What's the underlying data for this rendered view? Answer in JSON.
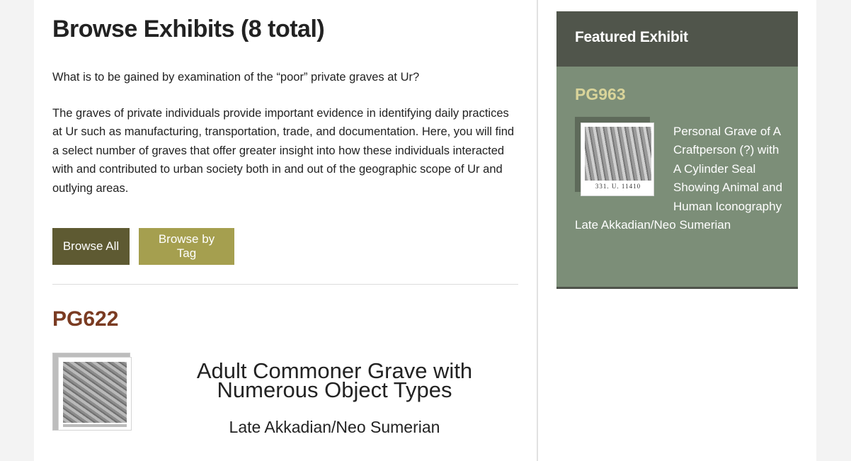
{
  "main": {
    "title": "Browse Exhibits (8 total)",
    "question": "What is to be gained by examination of the “poor” private graves at Ur?",
    "paragraph": "The graves of private individuals provide important evidence in identifying daily practices at Ur such as manufacturing, transportation, trade, and documentation. Here, you will find a select number of graves that offer greater insight into how these individuals interacted with and contributed to urban society both in and out of the geographic scope of Ur and outlying areas.",
    "buttons": {
      "browse_all": "Browse All",
      "browse_by_tag": "Browse by Tag"
    },
    "exhibit": {
      "id": "PG622",
      "title": "Adult Commoner Grave with Numerous Object Types",
      "period": "Late Akkadian/Neo Sumerian"
    }
  },
  "sidebar": {
    "heading": "Featured Exhibit",
    "exhibit": {
      "id": "PG963",
      "thumb_label": "331. U. 11410",
      "description": "Personal Grave of A Craftperson (?) with A Cylinder Seal Showing Animal and Human Iconography Late Akkadian/Neo Sumerian"
    }
  },
  "colors": {
    "browse_all_bg": "#5e5a32",
    "browse_by_tag_bg": "#a59f4f",
    "exhibit_id": "#7a3b22",
    "featured_bg": "#7c8e78",
    "featured_head_bg": "#50554b",
    "featured_id": "#d9d49a"
  }
}
